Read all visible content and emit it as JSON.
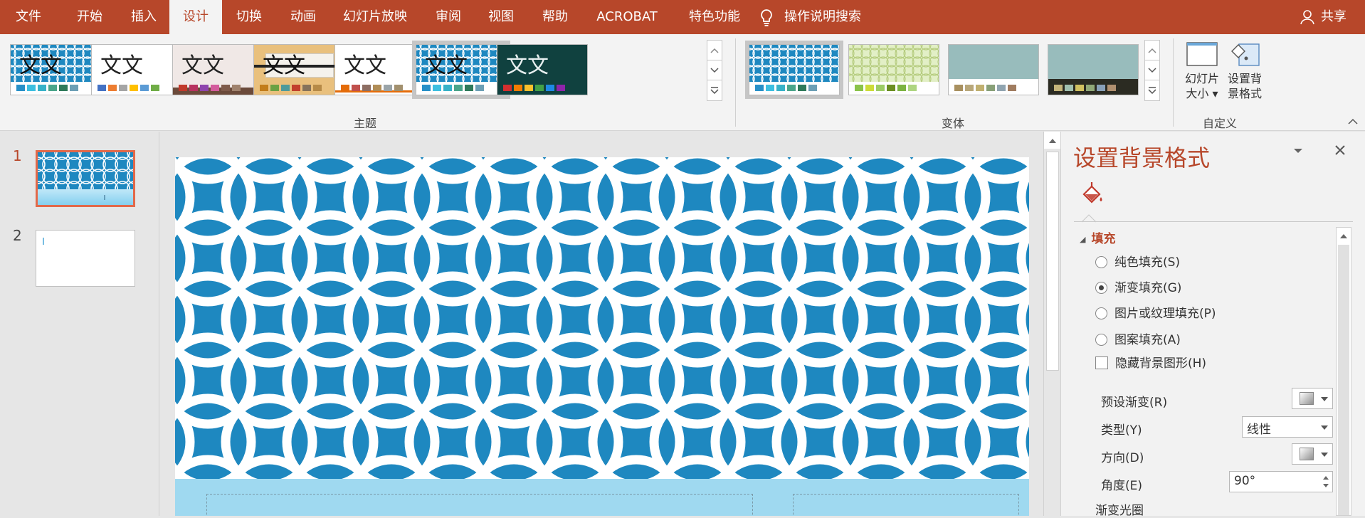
{
  "menu": {
    "tabs": [
      "文件",
      "开始",
      "插入",
      "设计",
      "切换",
      "动画",
      "幻灯片放映",
      "审阅",
      "视图",
      "帮助",
      "ACROBAT",
      "特色功能"
    ],
    "active_tab": "设计",
    "search_label": "操作说明搜索",
    "share_label": "共享"
  },
  "ribbon": {
    "themes_group_label": "主题",
    "variants_group_label": "变体",
    "customize_group_label": "自定义",
    "theme_thumb_text": "文文",
    "themes": [
      {
        "name": "theme-1",
        "bg": "#1e88c0",
        "text_color": "#111",
        "swatches": [
          "#2790c8",
          "#3dbfe0",
          "#38b2c8",
          "#4aa58a",
          "#2f7a5a",
          "#6c9fb5"
        ]
      },
      {
        "name": "theme-2",
        "bg": "#ffffff",
        "text_color": "#222",
        "swatches": [
          "#4472c4",
          "#ed7d31",
          "#a5a5a5",
          "#ffc000",
          "#5b9bd5",
          "#70ad47"
        ]
      },
      {
        "name": "theme-3",
        "bg": "#f0e8e6",
        "text_color": "#222",
        "swatches": [
          "#c0392b",
          "#b7325f",
          "#8e44ad",
          "#d35b9c",
          "#7f5a4a",
          "#a0826d"
        ]
      },
      {
        "name": "theme-4",
        "bg": "#e9c07d",
        "text_color": "#111",
        "swatches": [
          "#c27c1a",
          "#6ca143",
          "#4e9a9b",
          "#c2402c",
          "#86735b",
          "#b68a47"
        ]
      },
      {
        "name": "theme-5",
        "bg": "#ffffff",
        "text_color": "#222",
        "swatches": [
          "#e46c0a",
          "#c0504d",
          "#8d6e63",
          "#b08d57",
          "#9aa4a8",
          "#a2906e"
        ]
      },
      {
        "name": "theme-6",
        "bg": "#1e88c0",
        "text_color": "#111",
        "swatches": [
          "#2790c8",
          "#3dbfe0",
          "#38b2c8",
          "#4aa58a",
          "#2f7a5a",
          "#6c9fb5"
        ]
      },
      {
        "name": "theme-7",
        "bg": "#10413f",
        "text_color": "#e8f0f0",
        "swatches": [
          "#d32f2f",
          "#f57c00",
          "#fbc02d",
          "#43a047",
          "#1e88e5",
          "#8e24aa"
        ]
      }
    ],
    "variants": [
      {
        "name": "variant-1",
        "bg": "#1e88c0",
        "band": "#ffffff",
        "swatches": [
          "#2790c8",
          "#3dbfe0",
          "#38b2c8",
          "#4aa58a",
          "#2f7a5a",
          "#6c9fb5"
        ]
      },
      {
        "name": "variant-2",
        "bg": "#d8e8b0",
        "band": "#ffffff",
        "swatches": [
          "#8bc34a",
          "#cddc39",
          "#9ccc65",
          "#6b8e23",
          "#7cb342",
          "#aed581"
        ]
      },
      {
        "name": "variant-3",
        "bg": "#98bcbc",
        "band": "#ffffff",
        "swatches": [
          "#a89060",
          "#b8a77a",
          "#c0b070",
          "#88a078",
          "#90a4b0",
          "#a07c60"
        ]
      },
      {
        "name": "variant-4",
        "bg": "#98bcbc",
        "band": "#2b2b22",
        "swatches": [
          "#c4b47a",
          "#a0c0b0",
          "#d0c060",
          "#90a878",
          "#88a0b8",
          "#b09070"
        ]
      }
    ],
    "slide_size_label_1": "幻灯片",
    "slide_size_label_2": "大小",
    "format_bg_label_1": "设置背",
    "format_bg_label_2": "景格式"
  },
  "slides": [
    {
      "number": "1"
    },
    {
      "number": "2"
    }
  ],
  "format_pane": {
    "title": "设置背景格式",
    "section_fill": "填充",
    "options": {
      "solid": "纯色填充(S)",
      "gradient": "渐变填充(G)",
      "picture": "图片或纹理填充(P)",
      "pattern": "图案填充(A)"
    },
    "selected_option": "gradient",
    "hide_bg_graphics": "隐藏背景图形(H)",
    "preset_gradient_label": "预设渐变(R)",
    "type_label": "类型(Y)",
    "type_value": "线性",
    "direction_label": "方向(D)",
    "angle_label": "角度(E)",
    "angle_value": "90°",
    "gradient_stops_label": "渐变光圈"
  },
  "colors": {
    "accent": "#b7472a",
    "slide_pattern_bg": "#1e88c0",
    "slide_bottom": "#9fd9f0"
  }
}
